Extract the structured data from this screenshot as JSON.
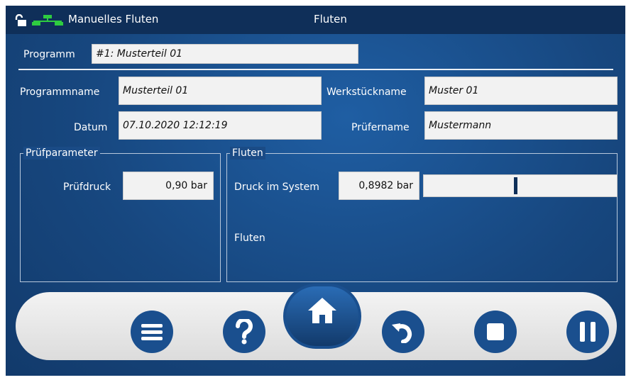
{
  "header": {
    "title": "Manuelles Fluten",
    "center_title": "Fluten"
  },
  "program": {
    "label": "Programm",
    "value": "#1: Musterteil 01"
  },
  "fields": {
    "programmname": {
      "label": "Programmname",
      "value": "Musterteil 01"
    },
    "werkstueckname": {
      "label": "Werkstückname",
      "value": "Muster 01"
    },
    "datum": {
      "label": "Datum",
      "value": "07.10.2020 12:12:19"
    },
    "pruefername": {
      "label": "Prüfername",
      "value": "Mustermann"
    }
  },
  "pruefparameter": {
    "title": "Prüfparameter",
    "druck_label": "Prüfdruck",
    "druck_value": "0,90 bar"
  },
  "fluten": {
    "title": "Fluten",
    "system_label": "Druck im System",
    "system_value": "0,8982 bar",
    "status": "Fluten"
  },
  "icons": {
    "lock": "unlock-icon",
    "network": "network-icon",
    "menu": "menu-icon",
    "help": "help-icon",
    "home": "home-icon",
    "back": "undo-icon",
    "stop": "stop-icon",
    "pause": "pause-icon"
  }
}
